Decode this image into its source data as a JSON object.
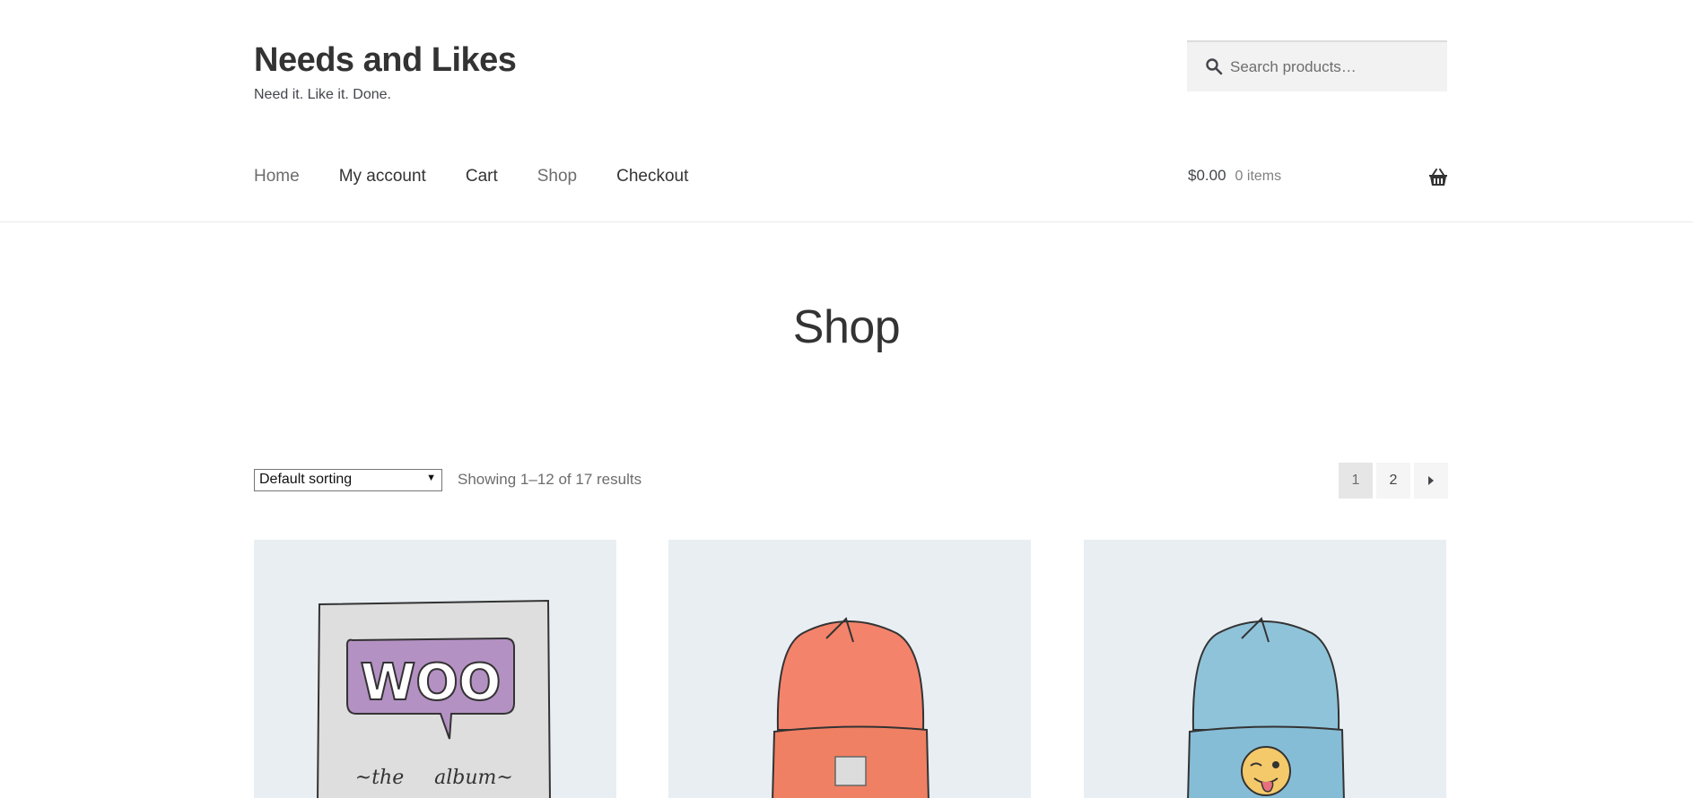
{
  "site": {
    "title": "Needs and Likes",
    "tagline": "Need it. Like it. Done."
  },
  "search": {
    "placeholder": "Search products…",
    "icon": "search-icon"
  },
  "nav": {
    "items": [
      "Home",
      "My account",
      "Cart",
      "Shop",
      "Checkout"
    ]
  },
  "cart": {
    "total": "$0.00",
    "items": "0 items",
    "icon": "basket-icon"
  },
  "page": {
    "title": "Shop"
  },
  "toolbar": {
    "sort_selected": "Default sorting",
    "result_count": "Showing 1–12 of 17 results"
  },
  "pagination": {
    "pages": [
      "1",
      "2"
    ],
    "current": "1",
    "next_icon": "triangle-right-icon"
  },
  "products": [
    {
      "image": "album-icon",
      "image_text_1": "WOO",
      "image_text_2": "~the",
      "image_text_3": "album~"
    },
    {
      "image": "beanie-icon",
      "color": "#f4836b"
    },
    {
      "image": "beanie-with-logo-icon",
      "color": "#8fc3d9"
    }
  ],
  "colors": {
    "text": "#43454b",
    "heading": "#333333",
    "muted": "#6d6d6d",
    "product_bg": "#e8eef2"
  }
}
